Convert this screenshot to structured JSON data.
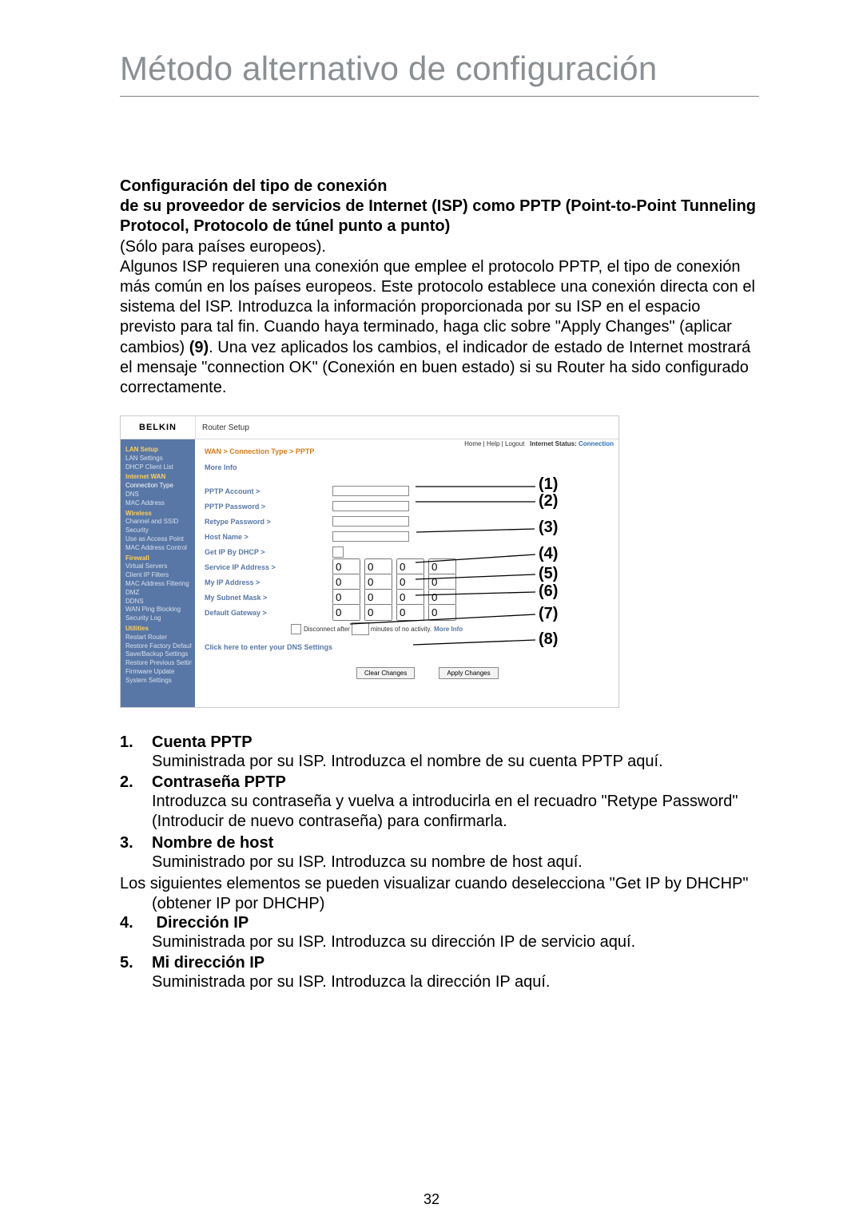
{
  "title": "Método alternativo de configuración",
  "intro_bold_1": "Configuración del tipo de conexión",
  "intro_bold_2": "de su proveedor de servicios de Internet (ISP) como PPTP (Point-to-Point Tunneling Protocol, Protocolo de túnel punto a punto)",
  "intro_note": "(Sólo para países europeos).",
  "intro_body_a": "Algunos ISP requieren una conexión que emplee el protocolo PPTP, el tipo de conexión más común en los países europeos. Este protocolo establece una conexión directa con el sistema del ISP. Introduzca la información proporcionada por su ISP en el espacio previsto para tal fin. Cuando haya terminado, haga clic sobre \"Apply Changes\" (aplicar cambios) ",
  "intro_body_b": "(9)",
  "intro_body_c": ". Una vez aplicados los cambios, el indicador de estado de Internet mostrará el mensaje \"connection OK\" (Conexión en buen estado) si su Router ha sido configurado correctamente.",
  "router": {
    "brand": "BELKIN",
    "setup_label": "Router Setup",
    "toplinks": "Home | Help | Logout",
    "status_label": "Internet Status:",
    "status_value": "Connection",
    "breadcrumb": "WAN > Connection Type > PPTP",
    "more_info": "More Info",
    "fields": {
      "pptp_account": "PPTP Account >",
      "pptp_password": "PPTP Password >",
      "retype_password": "Retype Password >",
      "host_name": "Host Name >",
      "get_ip_dhcp": "Get IP By DHCP >",
      "service_ip": "Service IP Address >",
      "my_ip": "My IP Address >",
      "subnet": "My Subnet Mask >",
      "gateway": "Default Gateway >"
    },
    "disconnect_a": "Disconnect after",
    "disconnect_b": "minutes of no activity.",
    "disconnect_more": "More Info",
    "dns_link": "Click here to enter your DNS Settings",
    "btn_clear": "Clear Changes",
    "btn_apply": "Apply Changes",
    "sidebar": [
      {
        "label": "LAN Setup",
        "type": "head"
      },
      {
        "label": "LAN Settings",
        "type": "item"
      },
      {
        "label": "DHCP Client List",
        "type": "item"
      },
      {
        "label": "Internet WAN",
        "type": "head"
      },
      {
        "label": "Connection Type",
        "type": "active"
      },
      {
        "label": "DNS",
        "type": "item"
      },
      {
        "label": "MAC Address",
        "type": "item"
      },
      {
        "label": "Wireless",
        "type": "head"
      },
      {
        "label": "Channel and SSID",
        "type": "item"
      },
      {
        "label": "Security",
        "type": "item"
      },
      {
        "label": "Use as Access Point",
        "type": "item"
      },
      {
        "label": "MAC Address Control",
        "type": "item"
      },
      {
        "label": "Firewall",
        "type": "head"
      },
      {
        "label": "Virtual Servers",
        "type": "item"
      },
      {
        "label": "Client IP Filters",
        "type": "item"
      },
      {
        "label": "MAC Address Filtering",
        "type": "item"
      },
      {
        "label": "DMZ",
        "type": "item"
      },
      {
        "label": "DDNS",
        "type": "item"
      },
      {
        "label": "WAN Ping Blocking",
        "type": "item"
      },
      {
        "label": "Security Log",
        "type": "item"
      },
      {
        "label": "Utilities",
        "type": "head"
      },
      {
        "label": "Restart Router",
        "type": "item"
      },
      {
        "label": "Restore Factory Defaults",
        "type": "item"
      },
      {
        "label": "Save/Backup Settings",
        "type": "item"
      },
      {
        "label": "Restore Previous Settings",
        "type": "item"
      },
      {
        "label": "Firmware Update",
        "type": "item"
      },
      {
        "label": "System Settings",
        "type": "item"
      }
    ],
    "ip_default": "0"
  },
  "callouts": [
    "(1)",
    "(2)",
    "(3)",
    "(4)",
    "(5)",
    "(6)",
    "(7)",
    "(8)"
  ],
  "list": [
    {
      "n": "1.",
      "t": "Cuenta PPTP",
      "d": "Suministrada por su ISP. Introduzca el nombre de su cuenta PPTP aquí."
    },
    {
      "n": "2.",
      "t": "Contraseña PPTP",
      "d": "Introduzca su contraseña y vuelva a introducirla en el recuadro \"Retype Password\" (Introducir de nuevo contraseña) para confirmarla."
    },
    {
      "n": "3.",
      "t": "Nombre de host",
      "d": "Suministrado por su ISP. Introduzca su nombre de host aquí."
    }
  ],
  "mid_line": "Los siguientes elementos se pueden visualizar cuando deselecciona \"Get IP by DHCHP\" (obtener IP por DHCHP)",
  "list2": [
    {
      "n": "4.",
      "t": " Dirección IP",
      "d": "Suministrada por su ISP. Introduzca su dirección IP de servicio aquí."
    },
    {
      "n": "5.",
      "t": "Mi dirección IP",
      "d": "Suministrada por su ISP. Introduzca la dirección IP aquí."
    }
  ],
  "page_number": "32"
}
